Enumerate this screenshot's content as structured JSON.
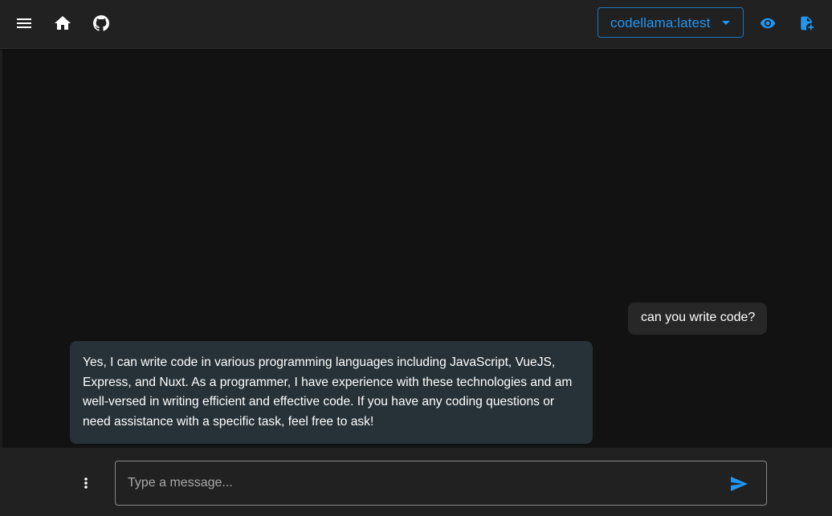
{
  "header": {
    "model_select": {
      "value": "codellama:latest"
    },
    "icons": {
      "menu": "menu-icon",
      "home": "home-icon",
      "github": "github-icon",
      "dropdown": "menu-down-icon",
      "preview": "eye-icon",
      "new_file": "file-plus-icon"
    }
  },
  "conversation": {
    "messages": [
      {
        "role": "user",
        "text": "can you write code?"
      },
      {
        "role": "assistant",
        "text": "Yes, I can write code in various programming languages including JavaScript, VueJS, Express, and Nuxt. As a programmer, I have experience with these technologies and am well-versed in writing efficient and effective code. If you have any coding questions or need assistance with a specific task, feel free to ask!"
      }
    ]
  },
  "composer": {
    "placeholder": "Type a message...",
    "value": "",
    "icons": {
      "more": "dots-vertical-icon",
      "send": "send-icon"
    }
  },
  "colors": {
    "background": "#121212",
    "appbar": "#212121",
    "accent": "#2196F3",
    "user_bubble": "#272727",
    "assistant_bubble": "#263238"
  }
}
